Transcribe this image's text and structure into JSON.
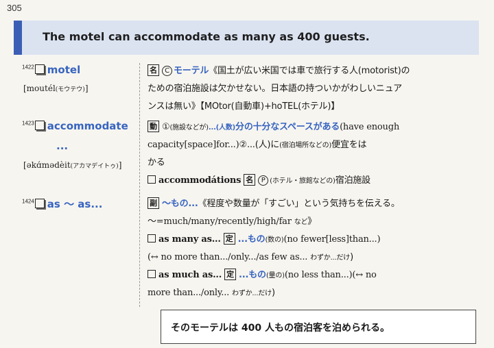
{
  "page": {
    "number": "305"
  },
  "banner": {
    "sentence": "The motel can accommodate as many as 400 guests."
  },
  "entries": [
    {
      "number": "1422",
      "headword": "motel",
      "pron": "[moutél",
      "pron_kana": "(モウテウ)",
      "pron_close": "]",
      "lines": [
        {
          "pos": "名",
          "mark": "C",
          "term": "モーテル",
          "text": "《国土が広い米国では車で旅行する人(motorist)の"
        },
        {
          "text": "ための宿泊施設は欠かせない。日本語の持ついかがわしいニュア"
        },
        {
          "text": "ンスは無い》【MOtor(自動車)+hoTEL(ホテル)】"
        }
      ]
    },
    {
      "number": "1423",
      "headword": "accommodate",
      "headword2": "...",
      "pron": "[əkɑ́mədèit",
      "pron_kana": "(アカマデイトゥ)",
      "pron_close": "]",
      "lines": [
        {
          "pos": "動",
          "sense": "①",
          "note": "(施設などが)",
          "obj": "...(人数)",
          "term": "分の十分なスペースがある",
          "text": "(have enough"
        },
        {
          "text": "capacity[space]for...)",
          "sense2": "②",
          "text2": "...(人)に",
          "note2": "(宿泊場所などの)",
          "text3": "便宜をは"
        },
        {
          "text": "かる"
        },
        {
          "derived": "accommodátions",
          "pos": "名",
          "mark": "P",
          "note": "(ホテル・旅館などの)",
          "text": "宿泊施設"
        }
      ]
    },
    {
      "number": "1424",
      "headword": "as 〜 as...",
      "lines": [
        {
          "pos": "副",
          "term": "〜もの...",
          "text": "《程度や数量が「すごい」という気持ちを伝える。"
        },
        {
          "text": "〜=much/many/recently/high/far",
          "note": "など",
          "close": "》"
        },
        {
          "phrase": "as many as...",
          "pos": "定",
          "term": "...もの",
          "note": "(数の)",
          "text": "(no fewer[less]than...)"
        },
        {
          "text": "(↔ no more than.../only.../as few as...",
          "note": "わずか...だけ",
          "close": ")"
        },
        {
          "phrase": "as much as...",
          "pos": "定",
          "term": "...もの",
          "note": "(量の)",
          "text": "(no less than...)(↔ no"
        },
        {
          "text": "more than.../only...",
          "note": "わずか...だけ",
          "close": ")"
        }
      ]
    }
  ],
  "translation": {
    "text": "そのモーテルは 400 人もの宿泊客を泊められる。"
  }
}
